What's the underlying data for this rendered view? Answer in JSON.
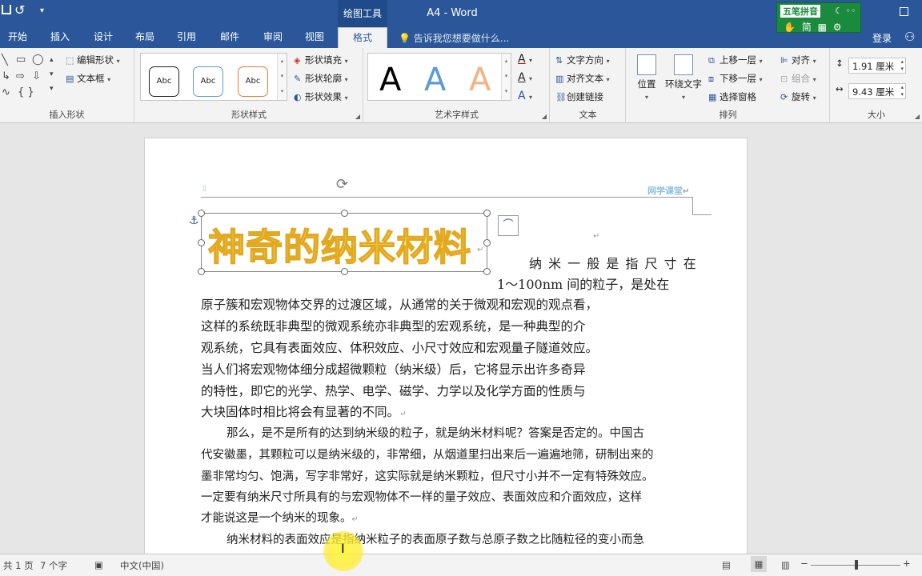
{
  "titlebar": {
    "context_tab": "绘图工具",
    "title": "A4 - Word",
    "ime": {
      "name": "五笔拼音",
      "row2": "简"
    },
    "icons": [
      "save-icon",
      "undo-icon",
      "customize-qat-icon",
      "restore-icon"
    ]
  },
  "tabs": [
    {
      "label": "开始"
    },
    {
      "label": "插入"
    },
    {
      "label": "设计"
    },
    {
      "label": "布局"
    },
    {
      "label": "引用"
    },
    {
      "label": "邮件"
    },
    {
      "label": "审阅"
    },
    {
      "label": "视图"
    },
    {
      "label": "格式",
      "active": true
    }
  ],
  "tell_me": "告诉我您想要做什么...",
  "login": "登录",
  "ribbon": {
    "insert_shapes": {
      "label": "插入形状",
      "edit_shape": "编辑形状",
      "text_box": "文本框"
    },
    "shape_styles": {
      "label": "形状样式",
      "swatches": [
        {
          "text": "Abc",
          "color": "#222222"
        },
        {
          "text": "Abc",
          "color": "#5b9bd5"
        },
        {
          "text": "Abc",
          "color": "#ed7d31"
        }
      ],
      "fill": "形状填充",
      "outline": "形状轮廓",
      "effects": "形状效果"
    },
    "wordart": {
      "label": "艺术字样式",
      "samples": [
        {
          "text": "A",
          "color": "#000000"
        },
        {
          "text": "A",
          "color": "#5b9bd5"
        },
        {
          "text": "A",
          "color": "#f4b183"
        }
      ]
    },
    "text": {
      "label": "文本",
      "direction": "文字方向",
      "align": "对齐文本",
      "link": "创建链接"
    },
    "arrange": {
      "label": "排列",
      "position": "位置",
      "wrap": "环绕文字",
      "forward": "上移一层",
      "backward": "下移一层",
      "selection_pane": "选择窗格",
      "align": "对齐",
      "group": "组合",
      "rotate": "旋转"
    },
    "size": {
      "label": "大小",
      "height": "1.91 厘米",
      "width": "9.43 厘米"
    }
  },
  "document": {
    "header_text": "网学课堂",
    "wordart_title": "神奇的纳米材料",
    "lines": [
      "纳 米 一 般 是 指 尺 寸 在",
      "1～100nm 间的粒子，是处在",
      "原子簇和宏观物体交界的过渡区域，从通常的关于微观和宏观的观点看，",
      "这样的系统既非典型的微观系统亦非典型的宏观系统，是一种典型的介",
      "观系统，它具有表面效应、体积效应、小尺寸效应和宏观量子隧道效应。",
      "当人们将宏观物体细分成超微颗粒（纳米级）后，它将显示出许多奇异",
      "的特性，即它的光学、热学、电学、磁学、力学以及化学方面的性质与",
      "大块固体时相比将会有显著的不同。"
    ],
    "lines2": [
      "那么，是不是所有的达到纳米级的粒子，就是纳米材料呢？答案是否定的。中国古",
      "代安徽墨，其颗粒可以是纳米级的，非常细，从烟道里扫出来后一遍遍地筛，研制出来的",
      "墨非常均匀、饱满，写字非常好，这实际就是纳米颗粒，但尺寸小并不一定有特殊效应。",
      "一定要有纳米尺寸所具有的与宏观物体不一样的量子效应、表面效应和介面效应，这样",
      "才能说这是一个纳米的现象。",
      "纳米材料的表面效应是指纳米粒子的表面原子数与总原子数之比随粒径的变小而急"
    ]
  },
  "statusbar": {
    "page": "共 1 页",
    "words": "7 个字",
    "lang": "中文(中国)",
    "zoom_minus": "−",
    "zoom_plus": "+"
  },
  "colors": {
    "brand": "#2b579a",
    "wordart_fill": "#f7e36a",
    "wordart_stroke": "#e2a81f",
    "ime": "#1a8a3c"
  }
}
